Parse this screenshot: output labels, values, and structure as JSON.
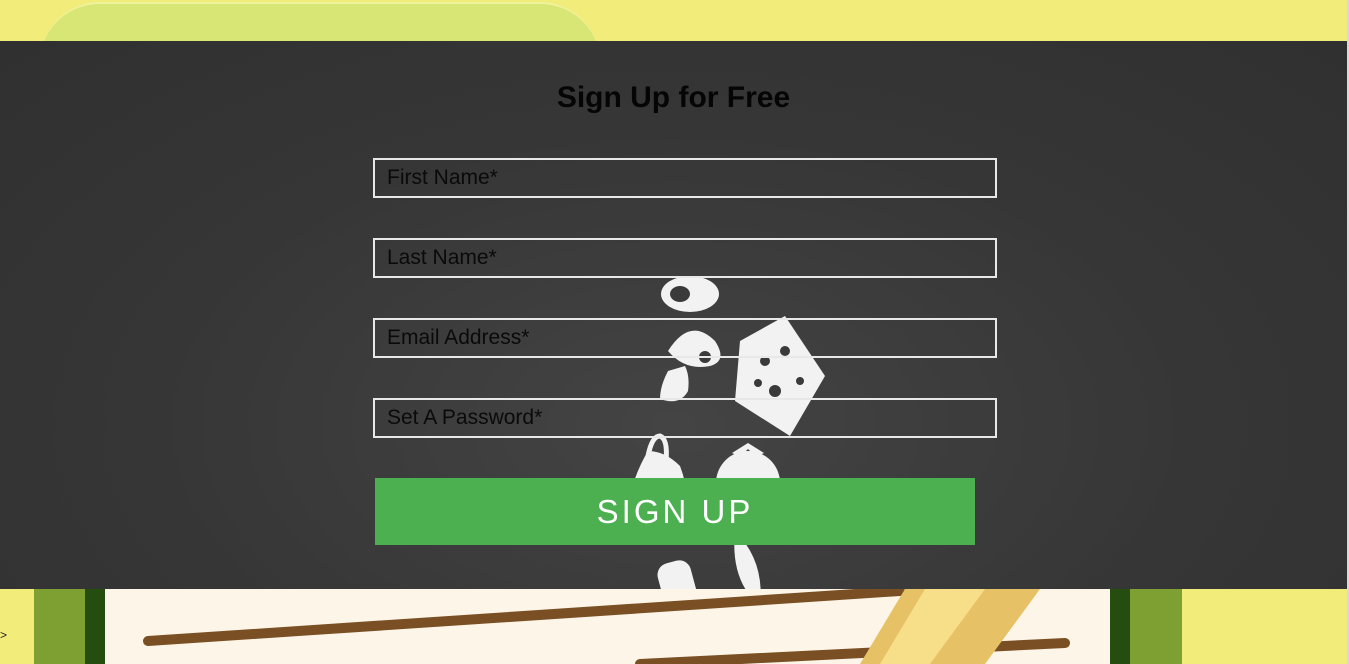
{
  "form": {
    "title": "Sign Up for Free",
    "first_name_placeholder": "First Name*",
    "last_name_placeholder": "Last Name*",
    "email_placeholder": "Email Address*",
    "password_placeholder": "Set A Password*",
    "submit_label": "SIGN UP"
  },
  "misc": {
    "edge_glyph": ">"
  },
  "colors": {
    "background_yellow": "#f2ec7a",
    "panel_dark": "#363636",
    "button_green": "#4caf50",
    "field_border": "#e8e8e8"
  }
}
